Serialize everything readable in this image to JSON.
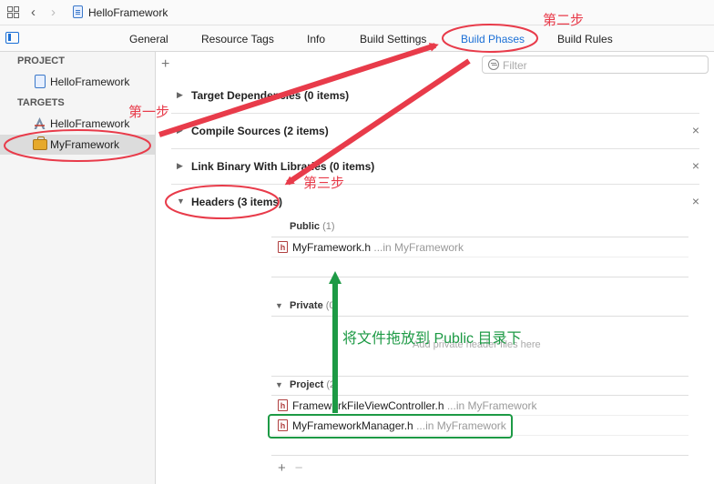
{
  "window": {
    "title": "HelloFramework"
  },
  "tabs": [
    {
      "label": "General"
    },
    {
      "label": "Resource Tags"
    },
    {
      "label": "Info"
    },
    {
      "label": "Build Settings"
    },
    {
      "label": "Build Phases"
    },
    {
      "label": "Build Rules"
    }
  ],
  "active_tab": "Build Phases",
  "sidebar": {
    "project_header": "PROJECT",
    "project_item": "HelloFramework",
    "targets_header": "TARGETS",
    "targets": [
      {
        "label": "HelloFramework"
      },
      {
        "label": "MyFramework"
      }
    ]
  },
  "main": {
    "add_label": "+",
    "filter_placeholder": "Filter",
    "phases": [
      {
        "title": "Target Dependencies (0 items)"
      },
      {
        "title": "Compile Sources (2 items)"
      },
      {
        "title": "Link Binary With Libraries (0 items)"
      },
      {
        "title": "Headers (3 items)"
      }
    ],
    "headers": {
      "public": {
        "label": "Public",
        "count": "(1)",
        "files": [
          {
            "name": "MyFramework.h",
            "location": "...in MyFramework"
          }
        ]
      },
      "private": {
        "label": "Private",
        "count": "(0)",
        "placeholder": "Add private header files here"
      },
      "project": {
        "label": "Project",
        "count": "(2)",
        "files": [
          {
            "name": "FrameworkFileViewController.h",
            "location": "...in MyFramework"
          },
          {
            "name": "MyFrameworkManager.h",
            "location": "...in MyFramework"
          }
        ]
      }
    },
    "bottom_plus": "+",
    "bottom_minus": "−",
    "close_glyph": "×"
  },
  "annotations": {
    "step1": "第一步",
    "step2": "第二步",
    "step3": "第三步",
    "drag_note": "将文件拖放到 Public 目录下"
  },
  "colors": {
    "accent": "#1a6fd6",
    "annotation_red": "#e83b4a",
    "annotation_green": "#1d9a45"
  },
  "icons": {
    "nav_grid": "grid-icon",
    "back": "chevron-left-icon",
    "forward": "chevron-right-icon",
    "header_file": "h-file-icon"
  }
}
